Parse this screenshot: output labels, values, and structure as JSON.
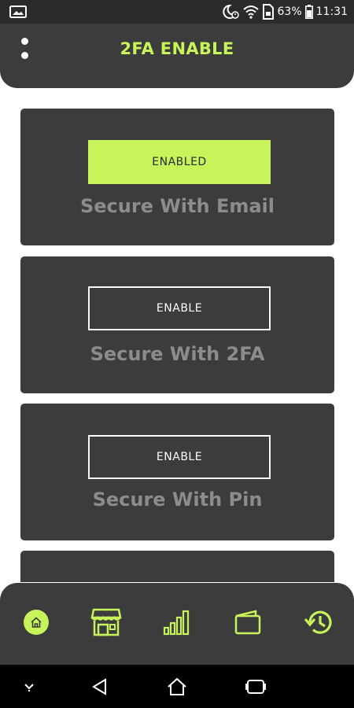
{
  "status_bar": {
    "battery": "63%",
    "time": "11:31",
    "icons": [
      "gallery-icon",
      "do-not-disturb-icon",
      "wifi-icon",
      "sim-icon",
      "battery-icon"
    ]
  },
  "app_bar": {
    "title": "2FA ENABLE",
    "menu_icon": "more-vertical-icon"
  },
  "cards": [
    {
      "button_label": "ENABLED",
      "label": "Secure With Email",
      "state": "enabled"
    },
    {
      "button_label": "ENABLE",
      "label": "Secure With 2FA",
      "state": "disabled"
    },
    {
      "button_label": "ENABLE",
      "label": "Secure With Pin",
      "state": "disabled"
    }
  ],
  "bottom_nav": {
    "items": [
      "home-icon",
      "store-icon",
      "stats-icon",
      "wallet-icon",
      "history-icon"
    ],
    "active": "home-icon",
    "accent_color": "#c6f45a"
  },
  "system_nav": {
    "items": [
      "collapse-icon",
      "back-icon",
      "home-icon",
      "recents-icon"
    ]
  },
  "colors": {
    "accent": "#c6f45a",
    "surface": "#3c3c3c",
    "label": "#8c8c8c"
  }
}
